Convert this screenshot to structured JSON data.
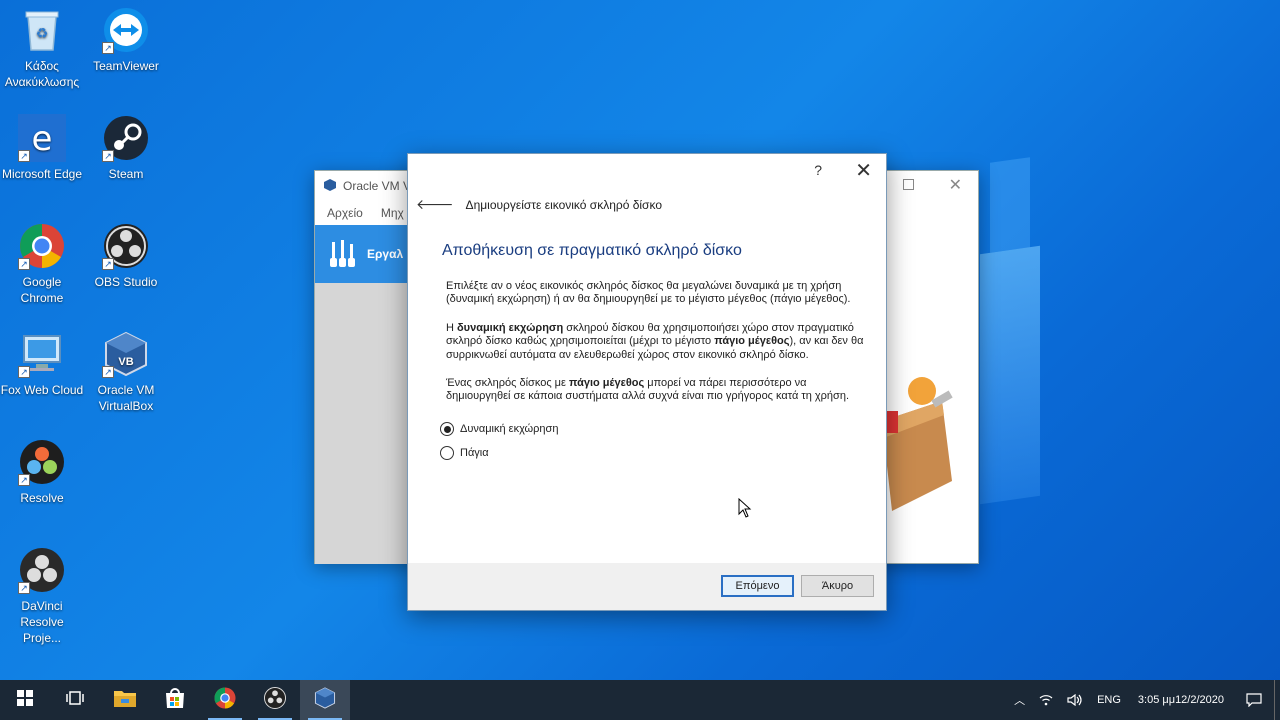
{
  "desktop": {
    "icons": [
      {
        "label": "Κάδος Ανακύκλωσης",
        "icon": "recycle-bin-icon"
      },
      {
        "label": "TeamViewer",
        "icon": "teamviewer-icon"
      },
      {
        "label": "Microsoft Edge",
        "icon": "edge-icon"
      },
      {
        "label": "Steam",
        "icon": "steam-icon"
      },
      {
        "label": "Google Chrome",
        "icon": "chrome-icon"
      },
      {
        "label": "OBS Studio",
        "icon": "obs-icon"
      },
      {
        "label": "Fox Web Cloud",
        "icon": "fox-web-cloud-icon"
      },
      {
        "label": "Oracle VM VirtualBox",
        "icon": "virtualbox-icon"
      },
      {
        "label": "Resolve",
        "icon": "resolve-icon"
      },
      {
        "label": "DaVinci Resolve Proje...",
        "icon": "davinci-project-icon"
      }
    ]
  },
  "bg_window": {
    "title": "Oracle VM V",
    "menu": [
      "Αρχείο",
      "Μηχ"
    ],
    "tools_label": "Εργαλ"
  },
  "dialog": {
    "help": "?",
    "header_title": "Δημιουργείστε εικονικό σκληρό δίσκο",
    "heading": "Αποθήκευση σε πραγματικό σκληρό δίσκο",
    "para1": "Επιλέξτε αν ο νέος εικονικός σκληρός δίσκος θα μεγαλώνει δυναμικά με τη χρήση (δυναμική εκχώρηση) ή αν θα δημιουργηθεί με το μέγιστο μέγεθος (πάγιο μέγεθος).",
    "para2": {
      "p1": "Η ",
      "b1": "δυναμική εκχώρηση",
      "p2": " σκληρού δίσκου θα χρησιμοποιήσει χώρο στον πραγματικό σκληρό δίσκο καθώς χρησιμοποιείται (μέχρι το μέγιστο ",
      "b2": "πάγιο μέγεθος",
      "p3": "), αν και δεν θα συρρικνωθεί αυτόματα αν ελευθερωθεί χώρος στον εικονικό σκληρό δίσκο."
    },
    "para3": {
      "p1": "Ένας σκληρός δίσκος με ",
      "b1": "πάγιο μέγεθος",
      "p2": " μπορεί να πάρει περισσότερο να δημιουργηθεί σε κάποια συστήματα αλλά συχνά είναι πιο γρήγορος κατά τη χρήση."
    },
    "options": [
      {
        "label": "Δυναμική εκχώρηση",
        "selected": true
      },
      {
        "label": "Πάγια",
        "selected": false
      }
    ],
    "next_label": "Επόμενο",
    "cancel_label": "Άκυρο"
  },
  "taskbar": {
    "apps": [
      "start-icon",
      "task-view-icon",
      "file-explorer-icon",
      "store-icon",
      "chrome-icon",
      "obs-icon",
      "virtualbox-icon"
    ],
    "lang": "ENG",
    "time": "3:05 μμ",
    "date": "12/2/2020"
  },
  "colors": {
    "desktop_bg": "#0a6fd8",
    "accent": "#2a6fc4",
    "heading": "#1a3d80",
    "taskbar": "#1b2836"
  }
}
